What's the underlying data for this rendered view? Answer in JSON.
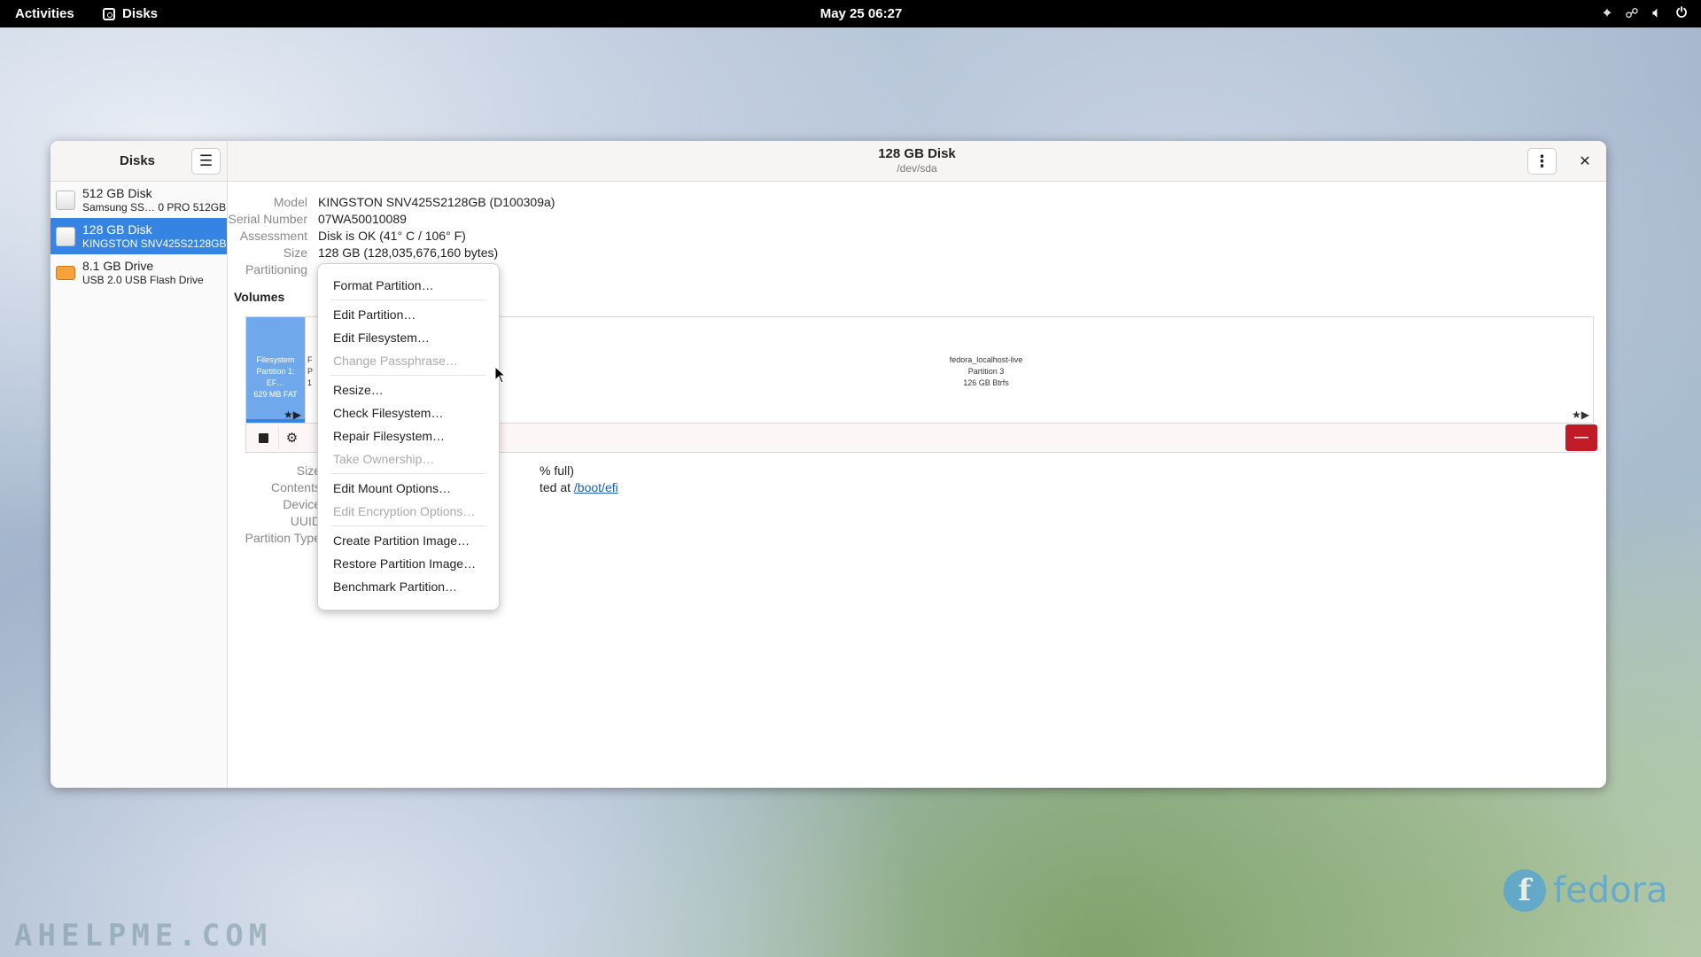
{
  "topbar": {
    "activities": "Activities",
    "app_name": "Disks",
    "clock": "May 25  06:27",
    "tray_icons": [
      "location-icon",
      "network-icon",
      "volume-icon",
      "power-icon"
    ]
  },
  "sidebar": {
    "title": "Disks",
    "drives": [
      {
        "name": "512 GB Disk",
        "sub": "Samsung SS… 0 PRO 512GB",
        "type": "hdd"
      },
      {
        "name": "128 GB Disk",
        "sub": "KINGSTON SNV425S2128GB",
        "type": "hdd",
        "selected": true
      },
      {
        "name": "8.1 GB Drive",
        "sub": "USB 2.0 USB Flash Drive",
        "type": "usb"
      }
    ]
  },
  "header": {
    "title": "128 GB Disk",
    "subtitle": "/dev/sda"
  },
  "disk": {
    "model_label": "Model",
    "model": "KINGSTON SNV425S2128GB (D100309a)",
    "serial_label": "Serial Number",
    "serial": "07WA50010089",
    "assessment_label": "Assessment",
    "assessment": "Disk is OK (41° C / 106° F)",
    "size_label": "Size",
    "size": "128 GB (128,035,676,160 bytes)",
    "partitioning_label": "Partitioning"
  },
  "volumes": {
    "label": "Volumes",
    "p1": {
      "line1": "Filesystem",
      "line2": "Partition 1: EF…",
      "line3": "629 MB FAT"
    },
    "p2": {
      "line1": "F",
      "line2": "P",
      "line3": "1"
    },
    "p3": {
      "line1": "fedora_localhost-live",
      "line2": "Partition 3",
      "line3": "126 GB Btrfs"
    }
  },
  "details": {
    "size_label": "Size",
    "size_value": "% full)",
    "contents_label": "Contents",
    "contents_value": "ted at ",
    "contents_link": "/boot/efi",
    "device_label": "Device",
    "uuid_label": "UUID",
    "ptype_label": "Partition Type"
  },
  "menu": {
    "items": [
      {
        "label": "Format Partition…",
        "enabled": true
      },
      {
        "sep": true
      },
      {
        "label": "Edit Partition…",
        "enabled": true
      },
      {
        "label": "Edit Filesystem…",
        "enabled": true
      },
      {
        "label": "Change Passphrase…",
        "enabled": false
      },
      {
        "sep": true
      },
      {
        "label": "Resize…",
        "enabled": true
      },
      {
        "label": "Check Filesystem…",
        "enabled": true
      },
      {
        "label": "Repair Filesystem…",
        "enabled": true
      },
      {
        "label": "Take Ownership…",
        "enabled": false
      },
      {
        "sep": true
      },
      {
        "label": "Edit Mount Options…",
        "enabled": true
      },
      {
        "label": "Edit Encryption Options…",
        "enabled": false
      },
      {
        "sep": true
      },
      {
        "label": "Create Partition Image…",
        "enabled": true
      },
      {
        "label": "Restore Partition Image…",
        "enabled": true
      },
      {
        "label": "Benchmark Partition…",
        "enabled": true
      }
    ]
  },
  "watermark": "AHELPME.COM",
  "fedora_logo_text": "fedora",
  "colors": {
    "accent": "#3584e4",
    "partition1": "#6fa8eb",
    "danger": "#c01c28",
    "usb": "#f5a23a"
  }
}
